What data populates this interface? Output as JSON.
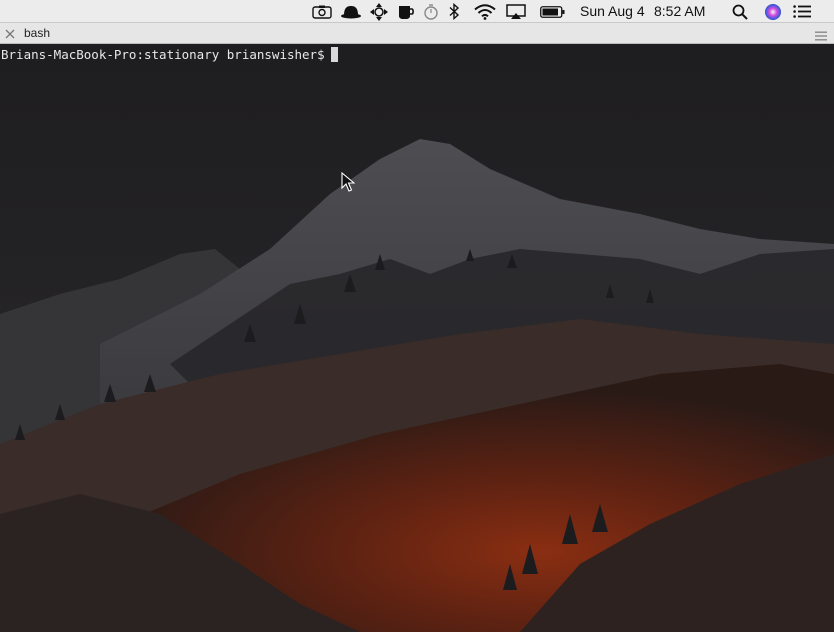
{
  "menubar": {
    "icons": [
      "screen-record-icon",
      "hat-icon",
      "move-arrows-icon",
      "coffee-mug-icon",
      "timer-icon",
      "bluetooth-icon",
      "wifi-icon",
      "airplay-icon",
      "battery-icon",
      "spotlight-search-icon",
      "siri-icon",
      "notification-center-icon"
    ],
    "date": "Sun Aug 4",
    "time": "8:52 AM"
  },
  "tab": {
    "title": "bash"
  },
  "terminal": {
    "prompt": "Brians-MacBook-Pro:stationary brianswisher$"
  },
  "colors": {
    "menubar_bg": "#ececec",
    "tabbar_bg": "#e6e6e6",
    "terminal_text": "#e8e8e8"
  }
}
